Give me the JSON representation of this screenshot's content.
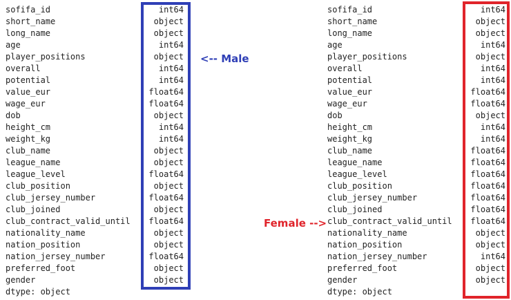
{
  "male": {
    "annotation": "<-- Male",
    "rows": [
      {
        "name": "sofifa_id",
        "dtype": "int64"
      },
      {
        "name": "short_name",
        "dtype": "object"
      },
      {
        "name": "long_name",
        "dtype": "object"
      },
      {
        "name": "age",
        "dtype": "int64"
      },
      {
        "name": "player_positions",
        "dtype": "object"
      },
      {
        "name": "overall",
        "dtype": "int64"
      },
      {
        "name": "potential",
        "dtype": "int64"
      },
      {
        "name": "value_eur",
        "dtype": "float64"
      },
      {
        "name": "wage_eur",
        "dtype": "float64"
      },
      {
        "name": "dob",
        "dtype": "object"
      },
      {
        "name": "height_cm",
        "dtype": "int64"
      },
      {
        "name": "weight_kg",
        "dtype": "int64"
      },
      {
        "name": "club_name",
        "dtype": "object"
      },
      {
        "name": "league_name",
        "dtype": "object"
      },
      {
        "name": "league_level",
        "dtype": "float64"
      },
      {
        "name": "club_position",
        "dtype": "object"
      },
      {
        "name": "club_jersey_number",
        "dtype": "float64"
      },
      {
        "name": "club_joined",
        "dtype": "object"
      },
      {
        "name": "club_contract_valid_until",
        "dtype": "float64"
      },
      {
        "name": "nationality_name",
        "dtype": "object"
      },
      {
        "name": "nation_position",
        "dtype": "object"
      },
      {
        "name": "nation_jersey_number",
        "dtype": "float64"
      },
      {
        "name": "preferred_foot",
        "dtype": "object"
      },
      {
        "name": "gender",
        "dtype": "object"
      }
    ],
    "footer": "dtype: object"
  },
  "female": {
    "annotation": "Female -->",
    "rows": [
      {
        "name": "sofifa_id",
        "dtype": "int64"
      },
      {
        "name": "short_name",
        "dtype": "object"
      },
      {
        "name": "long_name",
        "dtype": "object"
      },
      {
        "name": "age",
        "dtype": "int64"
      },
      {
        "name": "player_positions",
        "dtype": "object"
      },
      {
        "name": "overall",
        "dtype": "int64"
      },
      {
        "name": "potential",
        "dtype": "int64"
      },
      {
        "name": "value_eur",
        "dtype": "float64"
      },
      {
        "name": "wage_eur",
        "dtype": "float64"
      },
      {
        "name": "dob",
        "dtype": "object"
      },
      {
        "name": "height_cm",
        "dtype": "int64"
      },
      {
        "name": "weight_kg",
        "dtype": "int64"
      },
      {
        "name": "club_name",
        "dtype": "float64"
      },
      {
        "name": "league_name",
        "dtype": "float64"
      },
      {
        "name": "league_level",
        "dtype": "float64"
      },
      {
        "name": "club_position",
        "dtype": "float64"
      },
      {
        "name": "club_jersey_number",
        "dtype": "float64"
      },
      {
        "name": "club_joined",
        "dtype": "float64"
      },
      {
        "name": "club_contract_valid_until",
        "dtype": "float64"
      },
      {
        "name": "nationality_name",
        "dtype": "object"
      },
      {
        "name": "nation_position",
        "dtype": "object"
      },
      {
        "name": "nation_jersey_number",
        "dtype": "int64"
      },
      {
        "name": "preferred_foot",
        "dtype": "object"
      },
      {
        "name": "gender",
        "dtype": "object"
      }
    ],
    "footer": "dtype: object"
  },
  "colors": {
    "male_highlight": "#2f3fb6",
    "female_highlight": "#e0242b",
    "text": "#222222",
    "background": "#ffffff"
  }
}
